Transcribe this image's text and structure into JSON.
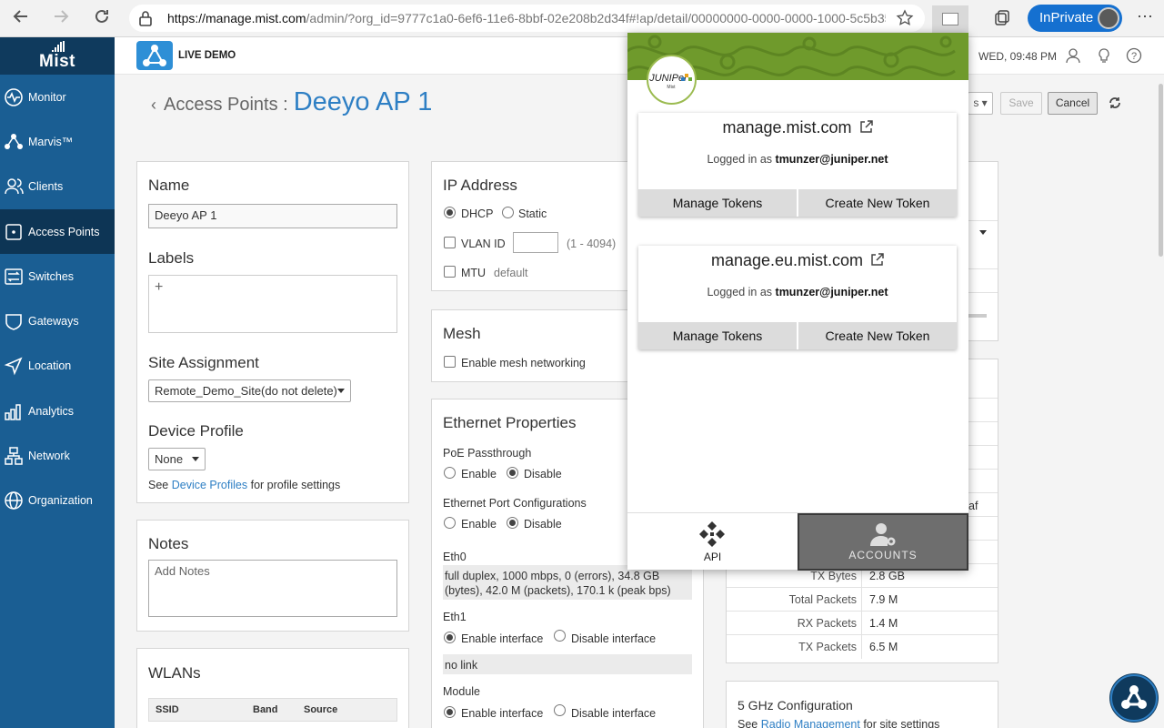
{
  "browser": {
    "url_domain": "https://manage.mist.com",
    "url_rest": "/admin/?org_id=9777c1a0-6ef6-11e6-8bbf-02e208b2d34f#!ap/detail/00000000-0000-0000-1000-5c5b350e4…",
    "inprivate_label": "InPrivate"
  },
  "sidebar": {
    "logo": "Mist",
    "items": [
      {
        "label": "Monitor",
        "icon": "monitor-icon"
      },
      {
        "label": "Marvis™",
        "icon": "marvis-icon"
      },
      {
        "label": "Clients",
        "icon": "clients-icon"
      },
      {
        "label": "Access Points",
        "icon": "access-point-icon"
      },
      {
        "label": "Switches",
        "icon": "switches-icon"
      },
      {
        "label": "Gateways",
        "icon": "gateways-icon"
      },
      {
        "label": "Location",
        "icon": "location-icon"
      },
      {
        "label": "Analytics",
        "icon": "analytics-icon"
      },
      {
        "label": "Network",
        "icon": "network-icon"
      },
      {
        "label": "Organization",
        "icon": "organization-icon"
      }
    ]
  },
  "topbar": {
    "demo_label": "LIVE DEMO",
    "clock": "WED, 09:48 PM"
  },
  "page": {
    "breadcrumb_parent": "Access Points :",
    "title": "Deeyo AP 1",
    "dropdown_partial": "s",
    "save_label": "Save",
    "cancel_label": "Cancel"
  },
  "left_card": {
    "name_label": "Name",
    "name_value": "Deeyo AP 1",
    "labels_label": "Labels",
    "labels_add": "+",
    "site_label": "Site Assignment",
    "site_value": "Remote_Demo_Site(do not delete)",
    "profile_label": "Device Profile",
    "profile_value": "None",
    "profile_help_pre": "See",
    "profile_help_link": "Device Profiles",
    "profile_help_post": "for profile settings"
  },
  "notes_card": {
    "label": "Notes",
    "placeholder": "Add Notes"
  },
  "wlans_card": {
    "label": "WLANs",
    "columns": [
      "SSID",
      "Band",
      "Source"
    ]
  },
  "ip_card": {
    "label": "IP Address",
    "dhcp": "DHCP",
    "static": "Static",
    "vlan_label": "VLAN ID",
    "vlan_range": "(1 - 4094)",
    "mtu_label": "MTU",
    "mtu_value": "default"
  },
  "mesh_card": {
    "label": "Mesh",
    "enable_label": "Enable mesh networking"
  },
  "eth_card": {
    "label": "Ethernet Properties",
    "poe_label": "PoE Passthrough",
    "enable": "Enable",
    "disable": "Disable",
    "port_label": "Ethernet Port Configurations",
    "eth0_label": "Eth0",
    "eth0_info": "full duplex, 1000 mbps, 0 (errors), 34.8 GB (bytes), 42.0 M (packets), 170.1 k (peak bps)",
    "eth1_label": "Eth1",
    "enable_iface": "Enable interface",
    "disable_iface": "Disable interface",
    "eth1_info": "no link",
    "module_label": "Module"
  },
  "stats": {
    "partial_value": "af",
    "rows": [
      {
        "key": "TX Bytes",
        "value": "2.8 GB"
      },
      {
        "key": "Total Packets",
        "value": "7.9 M"
      },
      {
        "key": "RX Packets",
        "value": "1.4 M"
      },
      {
        "key": "TX Packets",
        "value": "6.5 M"
      }
    ]
  },
  "radio_card": {
    "label": "5 GHz Configuration",
    "help_pre": "See",
    "help_link": "Radio Management",
    "help_post": "for site settings"
  },
  "popup": {
    "accounts": [
      {
        "domain": "manage.mist.com",
        "logged_pre": "Logged in as",
        "user": "tmunzer@juniper.net",
        "manage": "Manage Tokens",
        "create": "Create New Token"
      },
      {
        "domain": "manage.eu.mist.com",
        "logged_pre": "Logged in as",
        "user": "tmunzer@juniper.net",
        "manage": "Manage Tokens",
        "create": "Create New Token"
      }
    ],
    "tab_api": "API",
    "tab_accounts": "ACCOUNTS"
  },
  "colors": {
    "sidebar": "#1a5e93",
    "accent": "#2e7fc4",
    "popup_header": "#6f9a2c",
    "inprivate": "#1570d0"
  }
}
